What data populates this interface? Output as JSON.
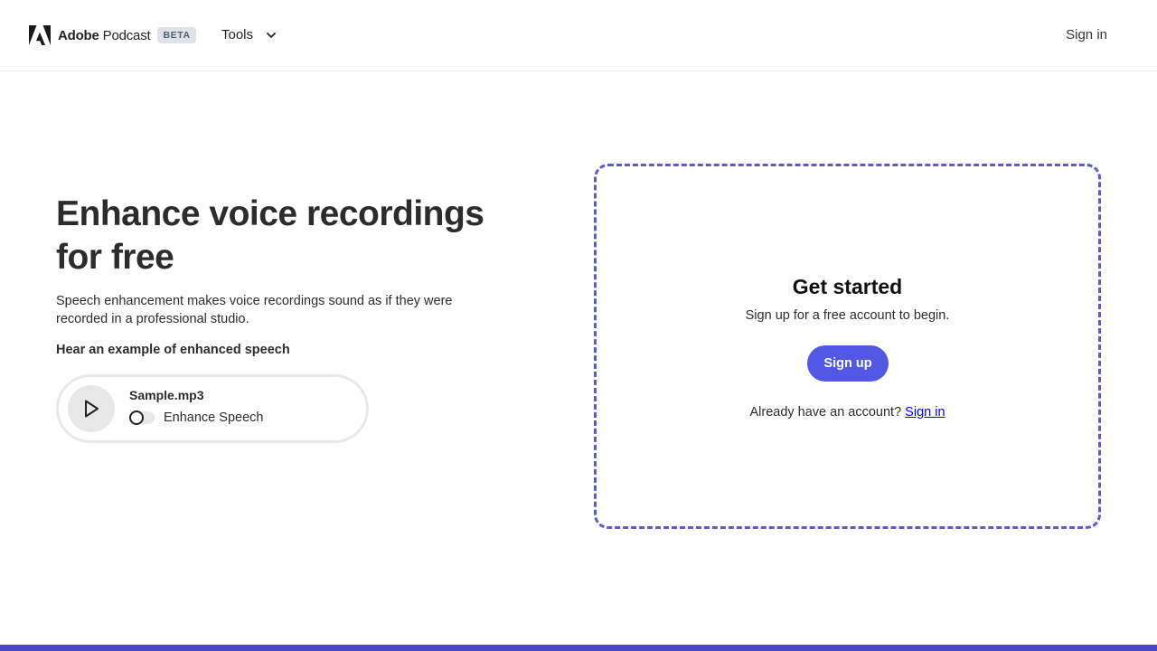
{
  "header": {
    "brand_company": "Adobe",
    "brand_product": "Podcast",
    "badge": "BETA",
    "tools_label": "Tools",
    "sign_in": "Sign in"
  },
  "hero": {
    "title": "Enhance voice recordings for free",
    "description": "Speech enhancement makes voice recordings sound as if they were recorded in a professional studio.",
    "example_heading": "Hear an example of enhanced speech",
    "player": {
      "file_name": "Sample.mp3",
      "toggle_label": "Enhance Speech",
      "toggle_on": false
    }
  },
  "panel": {
    "title": "Get started",
    "subtitle": "Sign up for a free account to begin.",
    "signup_button": "Sign up",
    "account_prompt": "Already have an account?",
    "signin_link": "Sign in"
  },
  "icons": {
    "logo": "adobe-logo-icon",
    "tools_dropdown": "chevron-down-icon",
    "play": "play-icon"
  },
  "colors": {
    "accent": "#5258e4",
    "dashed_border": "#5c5bc7",
    "bottom_bar": "#4a44c0",
    "badge_bg": "#dde3e8",
    "link": "#0000ee"
  }
}
